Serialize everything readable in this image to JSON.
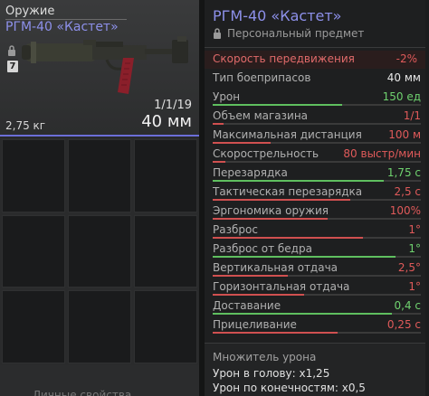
{
  "item_card": {
    "category": "Оружие",
    "name": "РГМ-40 «Кастет»",
    "slot_number": "7",
    "ammo": "1/1/19",
    "caliber": "40 мм",
    "weight": "2,75 кг"
  },
  "inventory": {
    "footer_text": "Личные свойства"
  },
  "details": {
    "title": "РГМ-40 «Кастет»",
    "personal_label": "Персональный предмет",
    "stats": [
      {
        "label": "Скорость передвижения",
        "value": "-2%",
        "color": "#e05a5a",
        "bar": null,
        "label_color": "#e06a6a",
        "highlight": true
      },
      {
        "label": "Тип боеприпасов",
        "value": "40 мм",
        "color": "#e8e8e8",
        "bar": null
      },
      {
        "label": "Урон",
        "value": "150 ед",
        "color": "#6fd26f",
        "bar": 0.62,
        "bar_color": "#5fbf5f"
      },
      {
        "label": "Объем магазина",
        "value": "1/1",
        "color": "#e05a5a",
        "bar": 0.05,
        "bar_color": "#d05050"
      },
      {
        "label": "Максимальная дистанция",
        "value": "100 м",
        "color": "#e05a5a",
        "bar": 0.28,
        "bar_color": "#d05050"
      },
      {
        "label": "Скорострельность",
        "value": "80 выстр/мин",
        "color": "#e05a5a",
        "bar": 0.06,
        "bar_color": "#d05050"
      },
      {
        "label": "Перезарядка",
        "value": "1,75 с",
        "color": "#6fd26f",
        "bar": 0.82,
        "bar_color": "#5fbf5f"
      },
      {
        "label": "Тактическая перезарядка",
        "value": "2,5 с",
        "color": "#e05a5a",
        "bar": 0.66,
        "bar_color": "#d05050"
      },
      {
        "label": "Эргономика оружия",
        "value": "100%",
        "color": "#e05a5a",
        "bar": 0.55,
        "bar_color": "#d05050"
      },
      {
        "label": "Разброс",
        "value": "1°",
        "color": "#e05a5a",
        "bar": 0.72,
        "bar_color": "#d05050"
      },
      {
        "label": "Разброс от бедра",
        "value": "1°",
        "color": "#6fd26f",
        "bar": 0.88,
        "bar_color": "#5fbf5f"
      },
      {
        "label": "Вертикальная отдача",
        "value": "2,5°",
        "color": "#e05a5a",
        "bar": 0.36,
        "bar_color": "#d05050"
      },
      {
        "label": "Горизонтальная отдача",
        "value": "1°",
        "color": "#e05a5a",
        "bar": 0.44,
        "bar_color": "#d05050"
      },
      {
        "label": "Доставание",
        "value": "0,4 с",
        "color": "#6fd26f",
        "bar": 0.86,
        "bar_color": "#5fbf5f"
      },
      {
        "label": "Прицеливание",
        "value": "0,25 с",
        "color": "#e05a5a",
        "bar": 0.6,
        "bar_color": "#d05050"
      }
    ],
    "multiplier": {
      "title": "Множитель урона",
      "head": "Урон в голову: x1,25",
      "limbs": "Урон по конечностям: x0,5"
    }
  },
  "colors": {
    "accent": "#8d90ea",
    "positive": "#5fbf5f",
    "negative": "#d05050"
  }
}
